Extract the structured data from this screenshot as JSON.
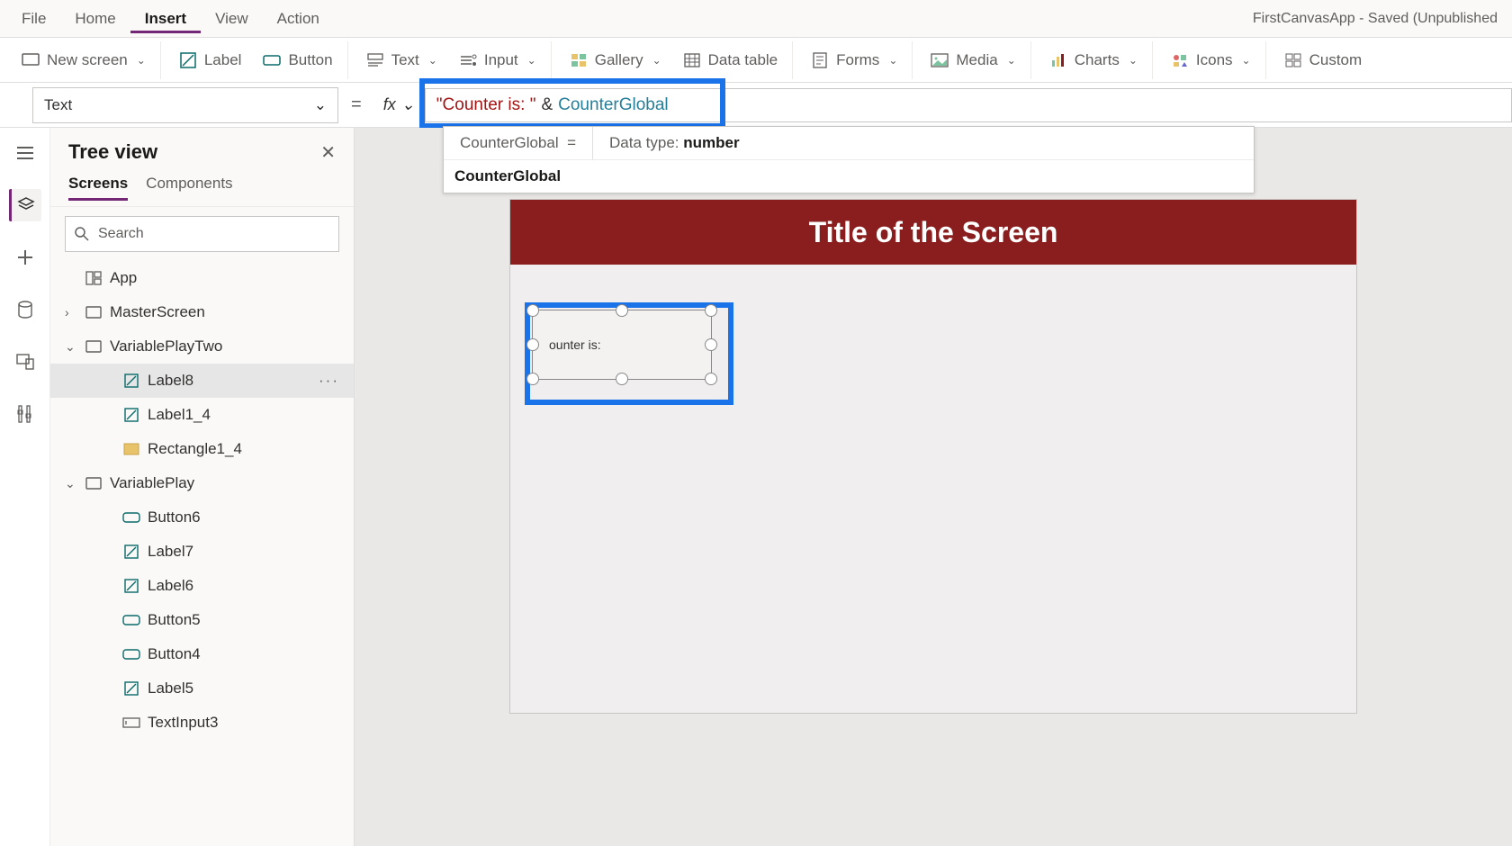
{
  "menu": {
    "items": [
      "File",
      "Home",
      "Insert",
      "View",
      "Action"
    ],
    "active": "Insert",
    "app_title": "FirstCanvasApp - Saved (Unpublished"
  },
  "ribbon": {
    "new_screen": "New screen",
    "label": "Label",
    "button": "Button",
    "text": "Text",
    "input": "Input",
    "gallery": "Gallery",
    "data_table": "Data table",
    "forms": "Forms",
    "media": "Media",
    "charts": "Charts",
    "icons": "Icons",
    "custom": "Custom"
  },
  "formula": {
    "property": "Text",
    "equals": "=",
    "fx": "fx",
    "tok_string": "\"Counter is: \"",
    "tok_op": "&",
    "tok_id": "CounterGlobal"
  },
  "info": {
    "varname": "CounterGlobal",
    "var_eq": "=",
    "datatype_label": "Data type:",
    "datatype_value": "number",
    "suggestion": "CounterGlobal"
  },
  "tree": {
    "title": "Tree view",
    "tabs": {
      "screens": "Screens",
      "components": "Components"
    },
    "search_placeholder": "Search",
    "nodes": [
      {
        "label": "App",
        "icon": "app",
        "depth": 0
      },
      {
        "label": "MasterScreen",
        "icon": "screen",
        "depth": 0,
        "expander": "›"
      },
      {
        "label": "VariablePlayTwo",
        "icon": "screen",
        "depth": 0,
        "expander": "⌄"
      },
      {
        "label": "Label8",
        "icon": "label",
        "depth": 2,
        "selected": true,
        "more": "···"
      },
      {
        "label": "Label1_4",
        "icon": "label",
        "depth": 2
      },
      {
        "label": "Rectangle1_4",
        "icon": "rect",
        "depth": 2
      },
      {
        "label": "VariablePlay",
        "icon": "screen",
        "depth": 0,
        "expander": "⌄"
      },
      {
        "label": "Button6",
        "icon": "button",
        "depth": 2
      },
      {
        "label": "Label7",
        "icon": "label",
        "depth": 2
      },
      {
        "label": "Label6",
        "icon": "label",
        "depth": 2
      },
      {
        "label": "Button5",
        "icon": "button",
        "depth": 2
      },
      {
        "label": "Button4",
        "icon": "button",
        "depth": 2
      },
      {
        "label": "Label5",
        "icon": "label",
        "depth": 2
      },
      {
        "label": "TextInput3",
        "icon": "textinput",
        "depth": 2
      }
    ]
  },
  "canvas": {
    "screen_title": "Title of the Screen",
    "label_preview": "ounter is:"
  }
}
